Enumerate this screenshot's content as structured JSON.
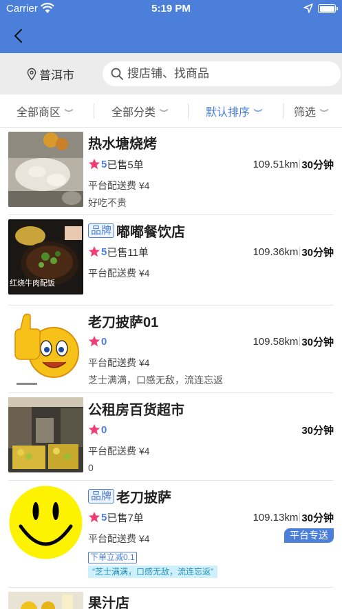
{
  "status_bar": {
    "carrier": "Carrier",
    "time": "5:19 PM"
  },
  "search_bar": {
    "city": "普洱市",
    "placeholder": "搜店铺、找商品"
  },
  "filters": [
    {
      "label": "全部商区",
      "active": false
    },
    {
      "label": "全部分类",
      "active": false
    },
    {
      "label": "默认排序",
      "active": true
    },
    {
      "label": "筛选",
      "active": false
    }
  ],
  "shops": [
    {
      "name": "热水塘烧烤",
      "brand": null,
      "score": "5",
      "sales": "已售5单",
      "distance": "109.51km",
      "time": "30分钟",
      "fee": "平台配送费 ¥4",
      "slogan": "好吃不贵"
    },
    {
      "name": "嘟嘟餐饮店",
      "brand": "品牌",
      "score": "5",
      "sales": "已售11单",
      "distance": "109.36km",
      "time": "30分钟",
      "fee": "平台配送费 ¥4",
      "thumb_caption": "红烧牛肉配饭"
    },
    {
      "name": "老刀披萨01",
      "brand": null,
      "score": "0",
      "sales": "",
      "distance": "109.58km",
      "time": "30分钟",
      "fee": "平台配送费 ¥4",
      "slogan": "芝士满满，口感无敌，流连忘返"
    },
    {
      "name": "公租房百货超市",
      "brand": null,
      "score": "0",
      "sales": "",
      "distance": "",
      "time": "30分钟",
      "fee": "平台配送费 ¥4",
      "slogan": "0"
    },
    {
      "name": "老刀披萨",
      "brand": "品牌",
      "score": "5",
      "sales": "已售7单",
      "distance": "109.13km",
      "time": "30分钟",
      "fee": "平台配送费 ¥4",
      "platform_badge": "平台专送",
      "promo": "下单立减0.1",
      "quote": "“芝士满满，口感无敌，流连忘返”"
    },
    {
      "name": "果汁店"
    }
  ],
  "colors": {
    "primary": "#4b7fd9",
    "star": "#ef3f74",
    "search_bg": "#ececec"
  }
}
